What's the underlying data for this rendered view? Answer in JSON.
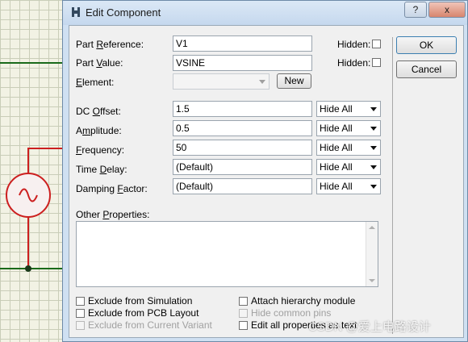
{
  "dialog": {
    "title": "Edit Component",
    "help_button": "?",
    "close_button": "x"
  },
  "fields": {
    "part_reference": {
      "label_pre": "Part ",
      "label_ul": "R",
      "label_post": "eference:",
      "value": "V1",
      "hidden_label": "Hidden:"
    },
    "part_value": {
      "label_pre": "Part ",
      "label_ul": "V",
      "label_post": "alue:",
      "value": "VSINE",
      "hidden_label": "Hidden:"
    },
    "element": {
      "label_pre": "",
      "label_ul": "E",
      "label_post": "lement:",
      "value": "",
      "new_button": "New"
    }
  },
  "properties": [
    {
      "label_pre": "DC ",
      "label_ul": "O",
      "label_post": "ffset:",
      "value": "1.5",
      "visibility": "Hide All"
    },
    {
      "label_pre": "A",
      "label_ul": "m",
      "label_post": "plitude:",
      "value": "0.5",
      "visibility": "Hide All"
    },
    {
      "label_pre": "",
      "label_ul": "F",
      "label_post": "requency:",
      "value": "50",
      "visibility": "Hide All"
    },
    {
      "label_pre": "Time ",
      "label_ul": "D",
      "label_post": "elay:",
      "value": "(Default)",
      "visibility": "Hide All"
    },
    {
      "label_pre": "Damping ",
      "label_ul": "F",
      "label_post": "actor:",
      "value": "(Default)",
      "visibility": "Hide All"
    }
  ],
  "other_properties": {
    "label_pre": "Other ",
    "label_ul": "P",
    "label_post": "roperties:",
    "value": ""
  },
  "buttons": {
    "ok": "OK",
    "cancel": "Cancel"
  },
  "checkboxes": {
    "exclude_simulation": "Exclude from Simulation",
    "exclude_pcb": "Exclude from PCB Layout",
    "exclude_variant": "Exclude from Current Variant",
    "attach_hierarchy": "Attach hierarchy module",
    "hide_common_pins": "Hide common pins",
    "edit_all_properties": "Edit all properties as text"
  },
  "watermark": "CSDN @爱上电路设计"
}
